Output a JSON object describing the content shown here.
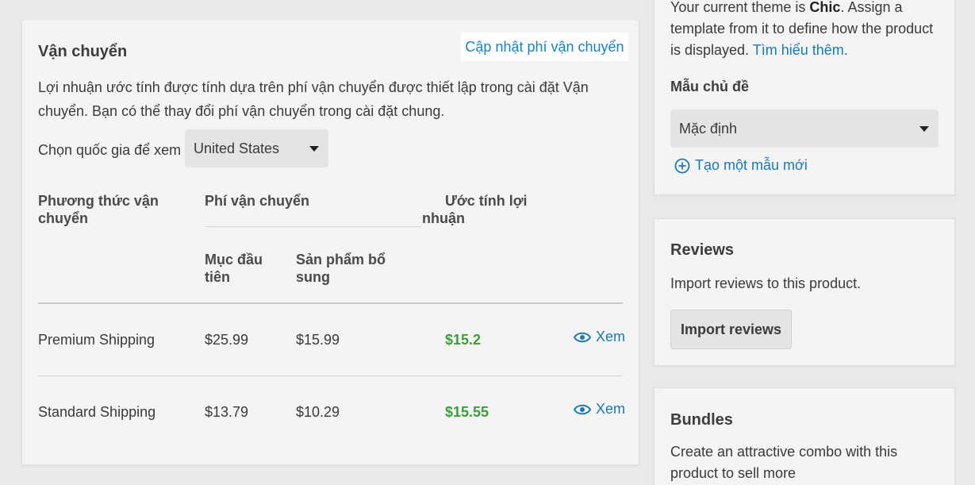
{
  "shipping": {
    "title": "Vận chuyển",
    "update_link": "Cập nhật phí vận chuyển",
    "description_line1": "Lợi nhuận ước tính được tính dựa trên phí vận chuyển được thiết lập trong cài đặt Vận",
    "description_line2": "chuyển. Bạn có thể thay đổi phí vận chuyển trong cài đặt chung.",
    "country_label": "Chọn quốc gia để xem",
    "country_value": "United States",
    "headers": {
      "method_line1": "Phương thức vận",
      "method_line2": "chuyển",
      "fee": "Phí vận chuyển",
      "profit_line1": "Ước tính lợi",
      "profit_line2": "nhuận",
      "first_item_line1": "Mục đầu",
      "first_item_line2": "tiên",
      "additional_line1": "Sản phẩm bổ",
      "additional_line2": "sung"
    },
    "rows": [
      {
        "method": "Premium Shipping",
        "first": "$25.99",
        "additional": "$15.99",
        "profit": "$15.2",
        "view": "Xem"
      },
      {
        "method": "Standard Shipping",
        "first": "$13.79",
        "additional": "$10.29",
        "profit": "$15.55",
        "view": "Xem"
      }
    ]
  },
  "theme": {
    "line1_pre": "Your current theme is ",
    "line1_bold": "Chic",
    "line1_post": ". Assign a",
    "line2": "template from it to define how the product",
    "line3_pre": "is displayed. ",
    "learn_more": "Tìm hiểu thêm.",
    "template_label": "Mẫu chủ đề",
    "template_value": "Mặc định",
    "create_template": "Tạo một mẫu mới"
  },
  "reviews": {
    "title": "Reviews",
    "description": "Import reviews to this product.",
    "button": "Import reviews"
  },
  "bundles": {
    "title": "Bundles",
    "line1": "Create an attractive combo with this",
    "line2": "product to sell more"
  },
  "colors": {
    "link": "#1a7ab8",
    "profit": "#3aa03a",
    "highlight_link": "#1384c9"
  }
}
